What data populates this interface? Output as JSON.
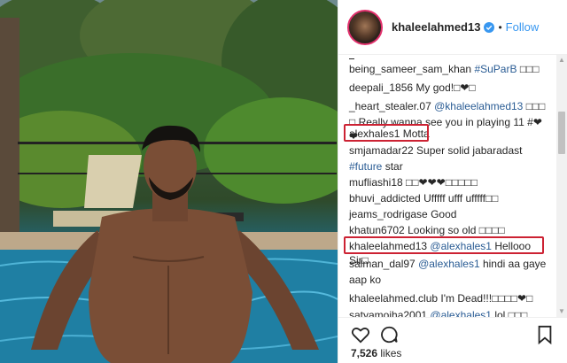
{
  "post": {
    "username": "khaleelahmed13",
    "follow_label": "Follow",
    "separator": "•",
    "likes_count": "7,526",
    "likes_label": "likes"
  },
  "comments": [
    {
      "user": "being_sameer_sam_khan",
      "parts": [
        {
          "t": "tag",
          "v": "#SuParB"
        },
        {
          "t": "text",
          "v": "□□□"
        }
      ]
    },
    {
      "user": "deepali_1856",
      "parts": [
        {
          "t": "text",
          "v": "My god!□❤□"
        }
      ]
    },
    {
      "user": "_heart_stealer.07",
      "parts": [
        {
          "t": "mention",
          "v": "@khaleelahmed13"
        },
        {
          "t": "text",
          "v": "□□□"
        }
      ]
    },
    {
      "user": "",
      "parts": [
        {
          "t": "text",
          "v": "□ Really wanna see you in playing 11 #❤❤"
        }
      ]
    },
    {
      "user": "alexhales1",
      "parts": [
        {
          "t": "text",
          "v": "Motta"
        }
      ]
    },
    {
      "user": "smjamadar22",
      "parts": [
        {
          "t": "text",
          "v": "Super solid jabaradast"
        }
      ]
    },
    {
      "user": "",
      "parts": [
        {
          "t": "tag",
          "v": "#future"
        },
        {
          "t": "text",
          "v": "star"
        }
      ]
    },
    {
      "user": "mufliashi18",
      "parts": [
        {
          "t": "text",
          "v": "□□❤❤❤□□□□□"
        }
      ]
    },
    {
      "user": "bhuvi_addicted",
      "parts": [
        {
          "t": "text",
          "v": "Ufffff ufff ufffff□□"
        }
      ]
    },
    {
      "user": "jeams_rodrigase",
      "parts": [
        {
          "t": "text",
          "v": "Good"
        }
      ]
    },
    {
      "user": "khatun6702",
      "parts": [
        {
          "t": "text",
          "v": "Looking so old □□□□"
        }
      ]
    },
    {
      "user": "khaleelahmed13",
      "parts": [
        {
          "t": "mention",
          "v": "@alexhales1"
        },
        {
          "t": "text",
          "v": "Hellooo Sir□"
        }
      ]
    },
    {
      "user": "salman_dal97",
      "parts": [
        {
          "t": "mention",
          "v": "@alexhales1"
        },
        {
          "t": "text",
          "v": "hindi aa gaye"
        }
      ]
    },
    {
      "user": "",
      "parts": [
        {
          "t": "text",
          "v": "aap ko"
        }
      ]
    },
    {
      "user": "khaleelahmed.club",
      "parts": [
        {
          "t": "text",
          "v": "I'm Dead!!!□□□□❤□"
        }
      ]
    },
    {
      "user": "satyamojha2001",
      "parts": [
        {
          "t": "mention",
          "v": "@alexhales1"
        },
        {
          "t": "text",
          "v": "lol □□□"
        }
      ]
    }
  ],
  "icons": {
    "verified": "verified-badge-icon",
    "like": "heart-icon",
    "comment": "comment-bubble-icon",
    "save": "bookmark-icon"
  },
  "colors": {
    "highlight_box": "#cc2233",
    "link": "#3897f0",
    "mention": "#2a5c94"
  }
}
